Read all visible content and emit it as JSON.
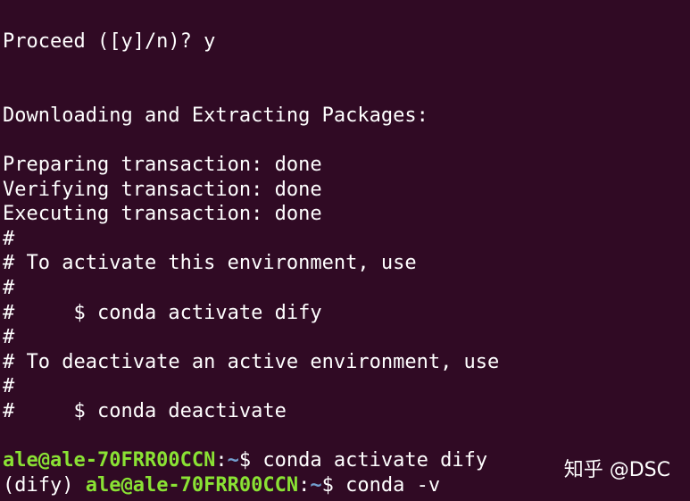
{
  "terminal": {
    "lines": [
      "Proceed ([y]/n)? y",
      "",
      "",
      "Downloading and Extracting Packages:",
      "",
      "Preparing transaction: done",
      "Verifying transaction: done",
      "Executing transaction: done",
      "#",
      "# To activate this environment, use",
      "#",
      "#     $ conda activate dify",
      "#",
      "# To deactivate an active environment, use",
      "#",
      "#     $ conda deactivate",
      ""
    ],
    "prompt1": {
      "user_host": "ale@ale-70FRR00CCN",
      "colon": ":",
      "path": "~",
      "symbol": "$ ",
      "command": "conda activate dify"
    },
    "prompt2": {
      "env": "(dify) ",
      "user_host": "ale@ale-70FRR00CCN",
      "colon": ":",
      "path": "~",
      "symbol": "$ ",
      "command": "conda -v"
    }
  },
  "watermark": "知乎 @DSC",
  "colors": {
    "background": "#300a24",
    "text": "#ffffff",
    "user_host": "#8ae234",
    "path": "#729fcf"
  }
}
